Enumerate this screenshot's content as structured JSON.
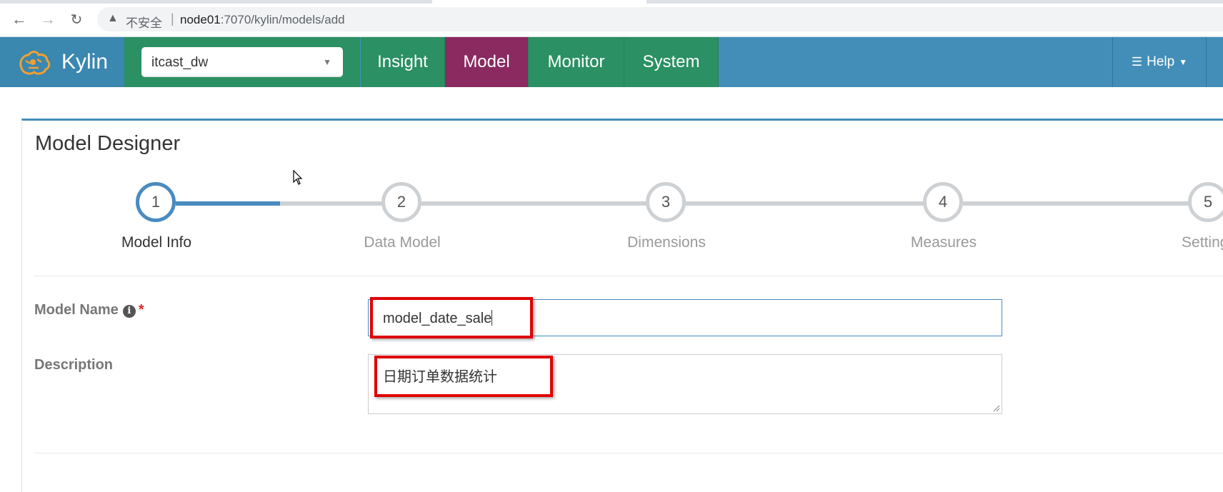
{
  "browser": {
    "security_label": "不安全",
    "url_host": "node01",
    "url_rest": ":7070/kylin/models/add"
  },
  "header": {
    "brand": "Kylin",
    "project": "itcast_dw",
    "nav": [
      {
        "label": "Insight",
        "active": false
      },
      {
        "label": "Model",
        "active": true
      },
      {
        "label": "Monitor",
        "active": false
      },
      {
        "label": "System",
        "active": false
      }
    ],
    "help_label": "Help"
  },
  "page": {
    "title": "Model Designer"
  },
  "steps": [
    {
      "number": "1",
      "label": "Model Info",
      "active": true
    },
    {
      "number": "2",
      "label": "Data Model",
      "active": false
    },
    {
      "number": "3",
      "label": "Dimensions",
      "active": false
    },
    {
      "number": "4",
      "label": "Measures",
      "active": false
    },
    {
      "number": "5",
      "label": "Settings",
      "active": false
    }
  ],
  "form": {
    "model_name_label": "Model Name",
    "model_name_value": "model_date_sale",
    "description_label": "Description",
    "description_value": "日期订单数据统计"
  },
  "colors": {
    "header_blue": "#438eb9",
    "nav_green": "#2b9063",
    "nav_active": "#8a2a61",
    "step_active": "#4a8bc0",
    "highlight_red": "#e00000"
  }
}
